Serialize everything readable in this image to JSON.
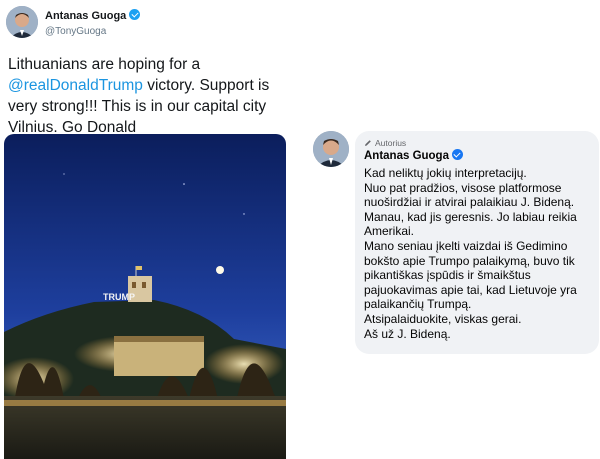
{
  "tweet": {
    "name": "Antanas Guoga",
    "handle": "@TonyGuoga",
    "text_before": "Lithuanians are hoping for a ",
    "mention": "@realDonaldTrump",
    "text_after": " victory. Support is  very strong!!! This is in our capital city Vilnius. Go Donald",
    "photo_sign": "TRUMP"
  },
  "comment": {
    "author_badge": "Autorius",
    "name": "Antanas Guoga",
    "paragraphs": [
      "Kad neliktų jokių interpretacijų.",
      "Nuo pat pradžios, visose platformose nuoširdžiai ir atvirai palaikiau J. Bideną.",
      "Manau, kad jis geresnis. Jo labiau reikia Amerikai.",
      "Mano seniau įkelti vaizdai iš Gedimino bokšto apie Trumpo palaikymą, buvo tik pikantiškas įspūdis ir šmaikštus pajuokavimas apie tai, kad Lietuvoje yra palaikančių Trumpą.",
      "Atsipalaiduokite, viskas gerai.",
      "Aš už J. Bideną."
    ]
  },
  "colors": {
    "twitter_blue": "#1da1f2",
    "mention": "#1b95e0",
    "facebook_blue": "#1877f2",
    "bubble": "#f0f2f5"
  }
}
